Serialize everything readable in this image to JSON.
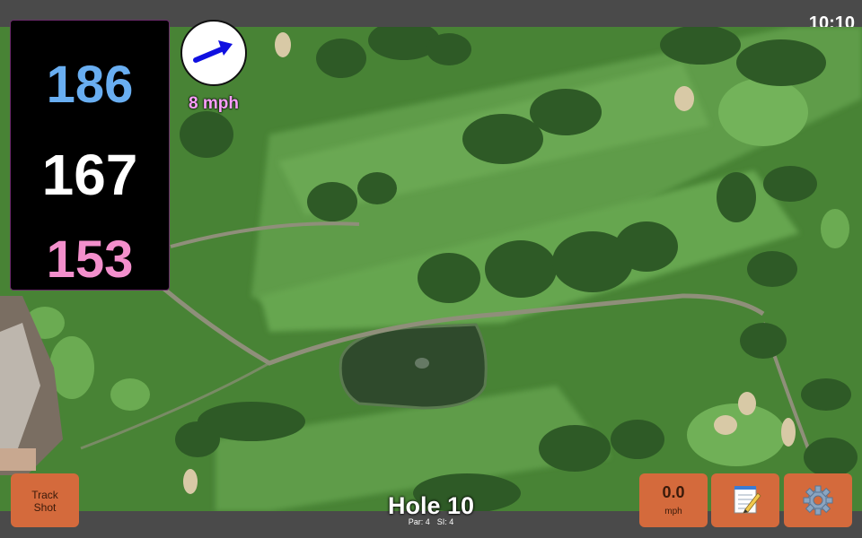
{
  "status_bar": {
    "time": "10:10"
  },
  "distances": {
    "back": "186",
    "middle": "167",
    "front": "153"
  },
  "wind": {
    "speed_label": "8 mph",
    "direction_icon": "wind-arrow-icon"
  },
  "buttons": {
    "track_shot": {
      "line1": "Track",
      "line2": "Shot"
    },
    "speed": {
      "value": "0.0",
      "unit": "mph"
    },
    "notes_icon": "notepad-icon",
    "settings_icon": "gear-icon"
  },
  "hole": {
    "title": "Hole 10",
    "par": "Par: 4",
    "si": "SI: 4"
  },
  "colors": {
    "back_distance": "#69aef1",
    "middle_distance": "#ffffff",
    "front_distance": "#f38fcc",
    "wind_label": "#fb9ffb",
    "button": "#d46a3c"
  }
}
